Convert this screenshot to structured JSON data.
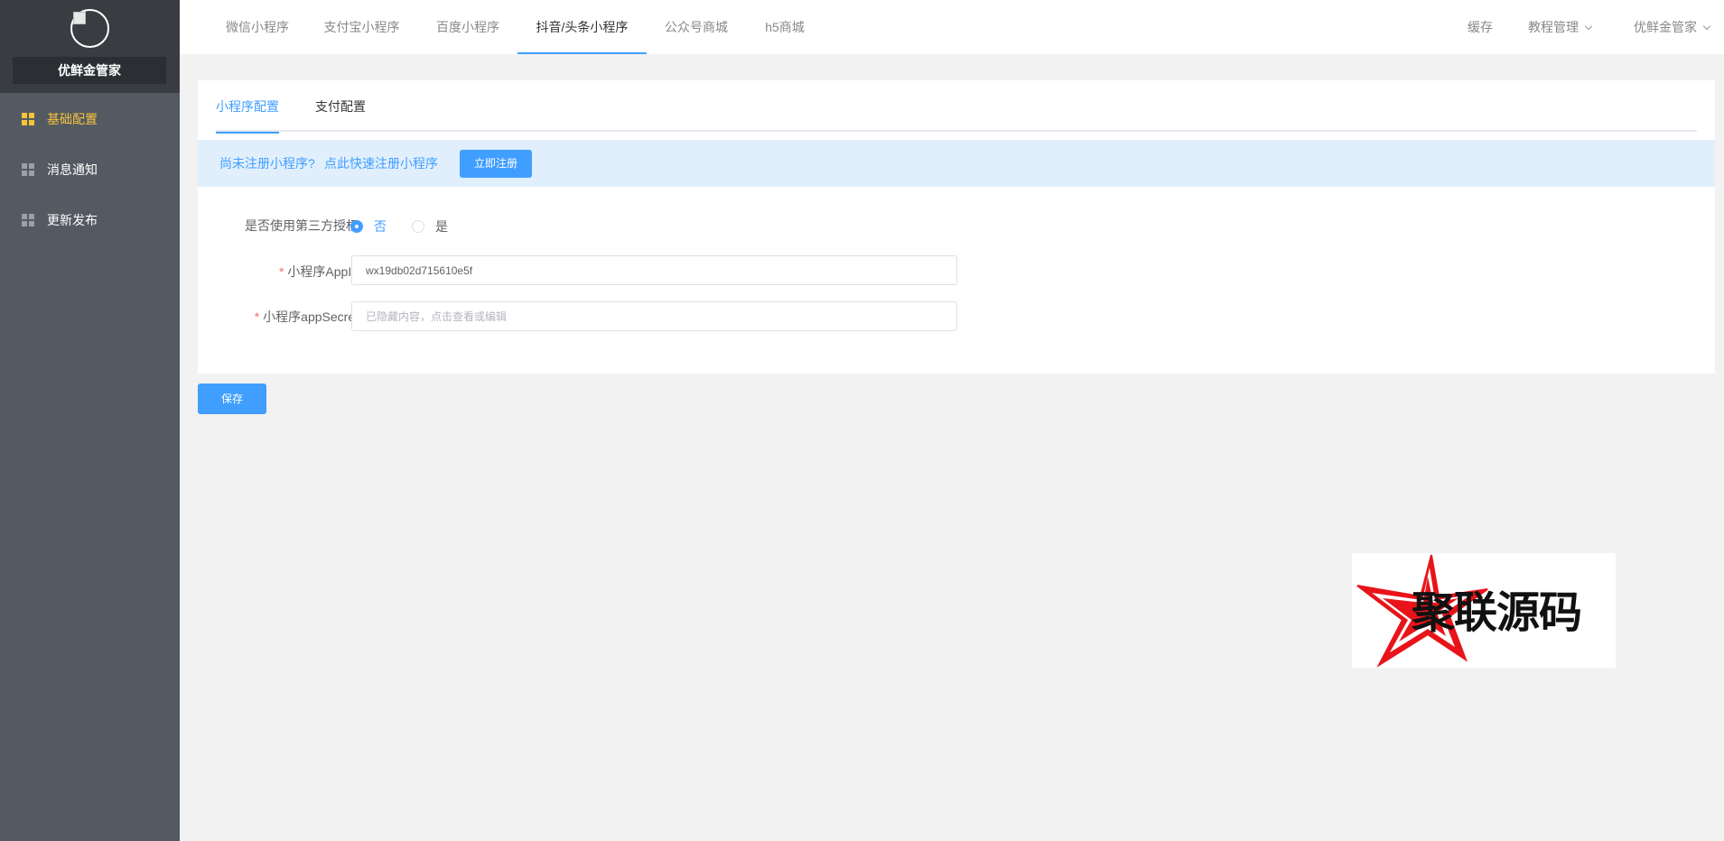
{
  "sidebar": {
    "shop_name": "优鲜金管家",
    "items": [
      {
        "label": "基础配置",
        "active": true
      },
      {
        "label": "消息通知",
        "active": false
      },
      {
        "label": "更新发布",
        "active": false
      }
    ]
  },
  "topnav": {
    "tabs": [
      {
        "label": "微信小程序"
      },
      {
        "label": "支付宝小程序"
      },
      {
        "label": "百度小程序"
      },
      {
        "label": "抖音/头条小程序"
      },
      {
        "label": "公众号商城"
      },
      {
        "label": "h5商城"
      }
    ],
    "active_tab": "抖音/头条小程序",
    "right": {
      "cache": "缓存",
      "tutorial": "教程管理",
      "user": "优鲜金管家"
    }
  },
  "config": {
    "subtabs": [
      {
        "label": "小程序配置"
      },
      {
        "label": "支付配置"
      }
    ],
    "active_subtab": "小程序配置",
    "notice": {
      "text": "尚未注册小程序?",
      "link": "点此快速注册小程序",
      "button": "立即注册"
    },
    "form": {
      "third_party_label": "是否使用第三方授权",
      "radio_no": "否",
      "radio_yes": "是",
      "third_party_value": "否",
      "appid_label": "小程序AppId",
      "appid_value": "wx19db02d715610e5f",
      "secret_label": "小程序appSecret",
      "secret_placeholder": "已隐藏内容，点击查看或编辑",
      "required_mark": "*"
    },
    "save_button": "保存"
  },
  "watermark": {
    "text": "聚联源码"
  },
  "colors": {
    "accent": "#409eff",
    "sidebar_active": "#f7c23c",
    "sidebar_bg": "#545a61",
    "sidebar_head": "#393d42"
  }
}
